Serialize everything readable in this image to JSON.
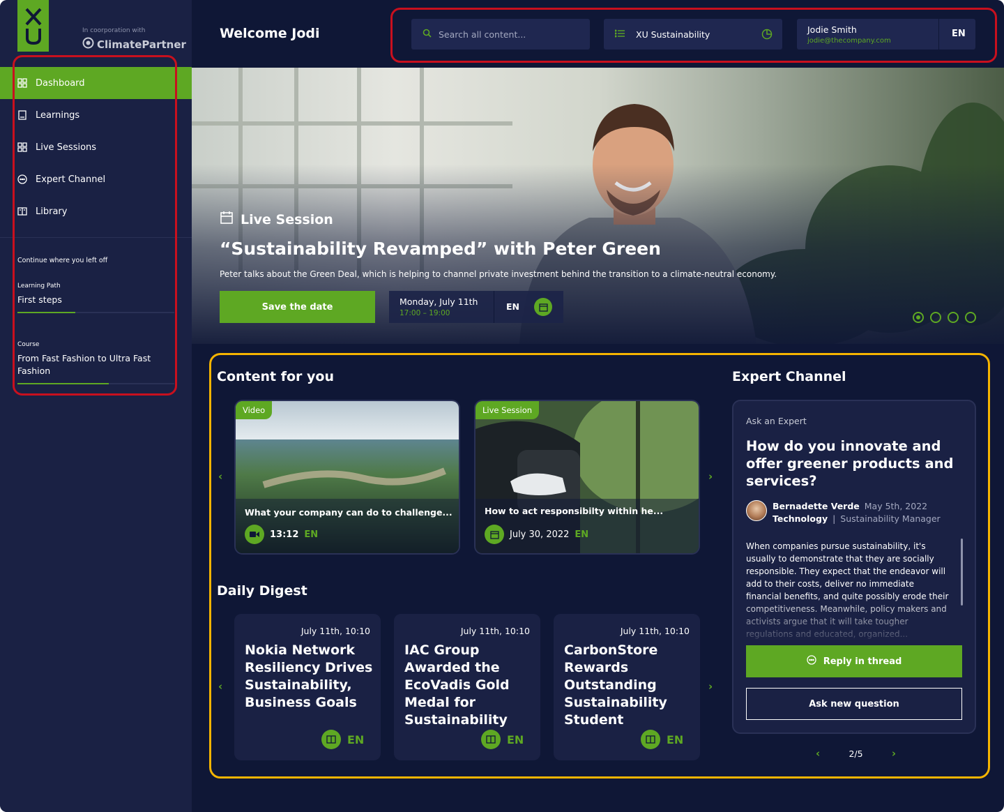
{
  "brand": {
    "logo_letters": "XU",
    "partner_prefix": "In coorporation with",
    "partner_name": "ClimatePartner",
    "accent": "#5ea823",
    "background": "#0f1736",
    "panel": "#1a2144"
  },
  "sidebar": {
    "items": [
      {
        "label": "Dashboard",
        "icon": "grid-icon",
        "active": true
      },
      {
        "label": "Learnings",
        "icon": "book-icon"
      },
      {
        "label": "Live Sessions",
        "icon": "grid-icon"
      },
      {
        "label": "Expert Channel",
        "icon": "chat-icon"
      },
      {
        "label": "Library",
        "icon": "open-book-icon"
      }
    ],
    "continue_title": "Continue where you left off",
    "continue": [
      {
        "type": "Learning Path",
        "name": "First steps",
        "progress": 0.37
      },
      {
        "type": "Course",
        "name": "From Fast Fashion to Ultra Fast Fashion",
        "progress": 0.58
      }
    ]
  },
  "header": {
    "welcome": "Welcome Jodi",
    "search_placeholder": "Search all content...",
    "workspace": "XU Sustainability",
    "user_name": "Jodie Smith",
    "user_email": "jodie@thecompany.com",
    "language": "EN"
  },
  "hero": {
    "label": "Live Session",
    "title": "“Sustainability Revamped” with Peter Green",
    "description": "Peter talks about the Green Deal, which is helping to channel private investment behind the transition to a climate-neutral economy.",
    "cta": "Save the date",
    "date": "Monday, July 11th",
    "time": "17:00 – 19:00",
    "language": "EN",
    "slides": 4,
    "active_slide": 0
  },
  "content_for_you": {
    "title": "Content for you",
    "cards": [
      {
        "tag": "Video",
        "text": "What your company can do to challenge...",
        "meta": "13:12",
        "language": "EN",
        "icon": "video-icon"
      },
      {
        "tag": "Live Session",
        "text": "How to act responsibilty within he...",
        "meta": "July 30, 2022",
        "language": "EN",
        "icon": "calendar-icon"
      }
    ]
  },
  "daily_digest": {
    "title": "Daily Digest",
    "cards": [
      {
        "date": "July 11th, 10:10",
        "title": "Nokia Network Resiliency Drives Sustainability, Business Goals",
        "language": "EN"
      },
      {
        "date": "July 11th, 10:10",
        "title": "IAC Group Awarded the EcoVadis Gold Medal for Sustainability",
        "language": "EN"
      },
      {
        "date": "July 11th, 10:10",
        "title": "CarbonStore Rewards Outstanding Sustainability Student",
        "language": "EN"
      }
    ]
  },
  "expert_channel": {
    "title": "Expert Channel",
    "label": "Ask an Expert",
    "question": "How do you innovate and offer greener products and services?",
    "author": "Bernadette Verde",
    "date": "May 5th, 2022",
    "department": "Technology",
    "separator": "|",
    "role": "Sustainability Manager",
    "body": "When companies pursue sustainability, it's usually to demonstrate that they are socially responsible. They expect that the endeavor will add to their costs, deliver no immediate financial benefits, and quite possibly erode their competitiveness. Meanwhile, policy makers and activists argue that it will take tougher regulations and educated, organized...",
    "reply_button": "Reply in thread",
    "ask_button": "Ask new question",
    "pager": "2/5"
  }
}
